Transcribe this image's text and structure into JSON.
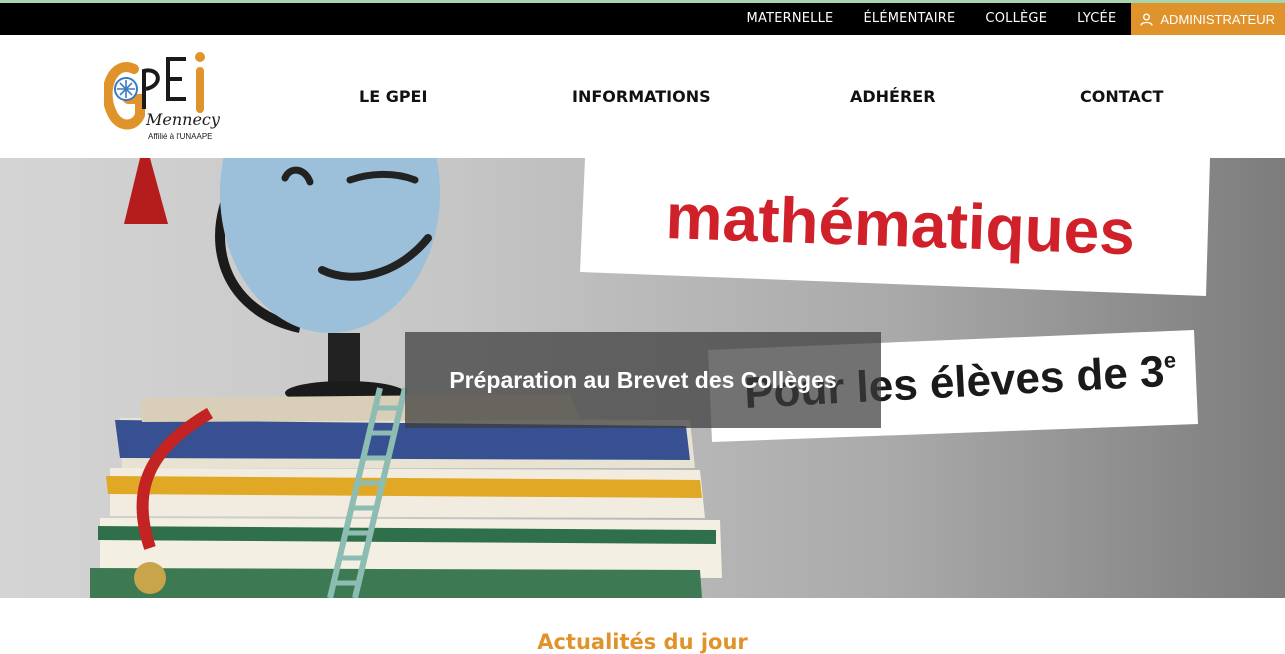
{
  "topbar": {
    "links": [
      "MATERNELLE",
      "ÉLÉMENTAIRE",
      "COLLÈGE",
      "LYCÉE"
    ],
    "admin_label": "ADMINISTRATEUR"
  },
  "logo": {
    "text_main": "GPEI",
    "text_town": "Mennecy",
    "text_affiliation": "Affilié à l'UNAAPE"
  },
  "nav": {
    "items": [
      "LE GPEI",
      "INFORMATIONS",
      "ADHÉRER",
      "CONTACT"
    ]
  },
  "hero": {
    "banner_top": "mathématiques",
    "banner_bottom": "Pour les élèves de 3",
    "banner_bottom_sup": "e",
    "caption": "Préparation au Brevet des Collèges"
  },
  "section": {
    "title": "Actualités du jour"
  },
  "colors": {
    "accent": "#e0932a",
    "topbar_bg": "#000000",
    "banner_red": "#d0202a"
  }
}
